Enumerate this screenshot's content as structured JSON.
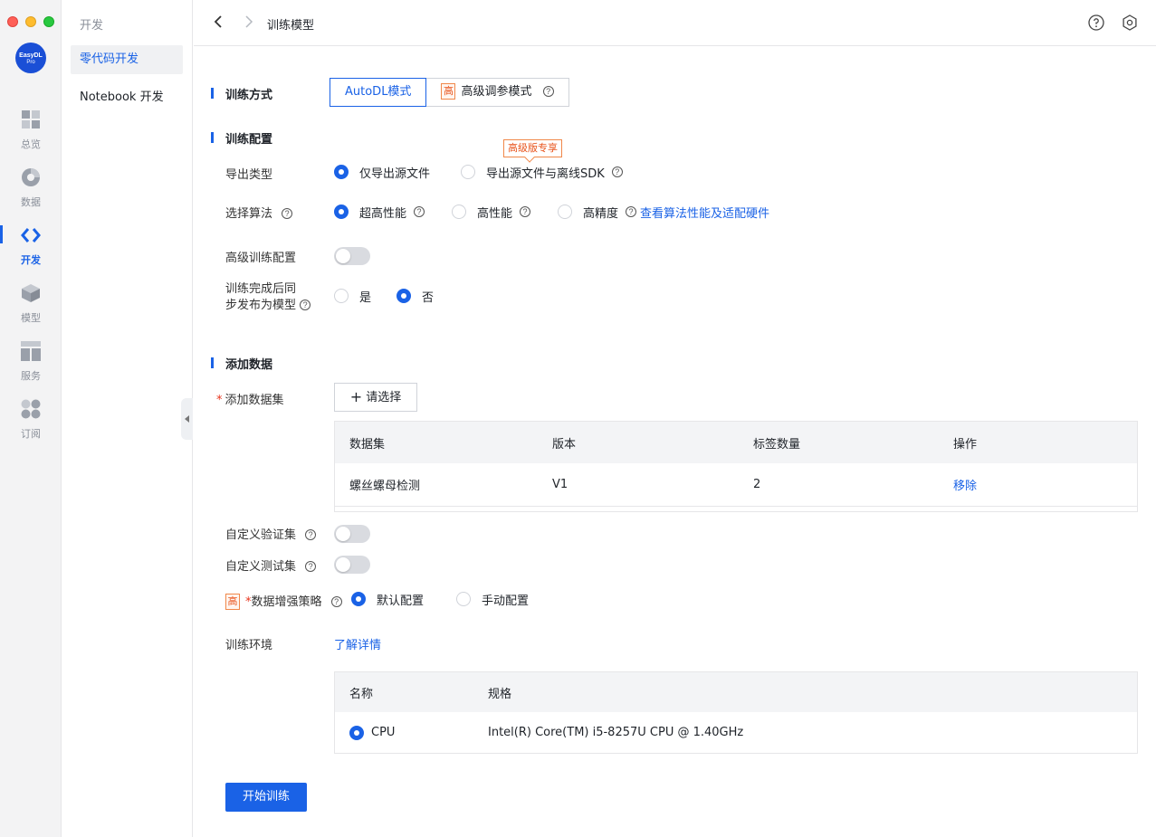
{
  "rail": {
    "logo_text": "EasyDL",
    "logo_sub": "Pro",
    "items": [
      {
        "label": "总览",
        "icon": "dashboard-icon"
      },
      {
        "label": "数据",
        "icon": "pie-chart-icon"
      },
      {
        "label": "开发",
        "icon": "code-icon"
      },
      {
        "label": "模型",
        "icon": "cube-icon"
      },
      {
        "label": "服务",
        "icon": "layout-icon"
      },
      {
        "label": "订阅",
        "icon": "apps-icon"
      }
    ],
    "active_index": 2
  },
  "sidebar": {
    "title": "开发",
    "items": [
      {
        "label": "零代码开发"
      },
      {
        "label": "Notebook 开发"
      }
    ]
  },
  "header": {
    "title": "训练模型"
  },
  "train_mode": {
    "section_title": "训练方式",
    "options": [
      "AutoDL模式",
      "高级调参模式"
    ],
    "advanced_badge": "高",
    "selected": "AutoDL模式"
  },
  "train_config": {
    "section_title": "训练配置",
    "export_type": {
      "label": "导出类型",
      "options": [
        "仅导出源文件",
        "导出源文件与离线SDK"
      ],
      "selected": "仅导出源文件",
      "pro_tag": "高级版专享"
    },
    "algorithm": {
      "label": "选择算法",
      "options": [
        "超高性能",
        "高性能",
        "高精度"
      ],
      "selected": "超高性能",
      "link": "查看算法性能及适配硬件"
    },
    "advanced_config": {
      "label": "高级训练配置",
      "enabled": false
    },
    "publish": {
      "label_line1": "训练完成后同",
      "label_line2": "步发布为模型",
      "options": [
        "是",
        "否"
      ],
      "selected": "否"
    }
  },
  "add_data": {
    "section_title": "添加数据",
    "dataset_label": "添加数据集",
    "select_button": "请选择",
    "table": {
      "columns": [
        "数据集",
        "版本",
        "标签数量",
        "操作"
      ],
      "rows": [
        {
          "name": "螺丝螺母检测",
          "version": "V1",
          "labels": "2",
          "action": "移除"
        }
      ]
    },
    "custom_validation": {
      "label": "自定义验证集",
      "enabled": false
    },
    "custom_test": {
      "label": "自定义测试集",
      "enabled": false
    },
    "augmentation": {
      "badge": "高",
      "label": "数据增强策略",
      "options": [
        "默认配置",
        "手动配置"
      ],
      "selected": "默认配置"
    },
    "environment": {
      "label": "训练环境",
      "link": "了解详情",
      "columns": [
        "名称",
        "规格"
      ],
      "rows": [
        {
          "name": "CPU",
          "spec": "Intel(R) Core(TM) i5-8257U CPU @ 1.40GHz",
          "selected": true
        }
      ]
    }
  },
  "start_button": "开始训练",
  "colors": {
    "accent": "#1a62e6",
    "pro_orange": "#e8541c"
  }
}
